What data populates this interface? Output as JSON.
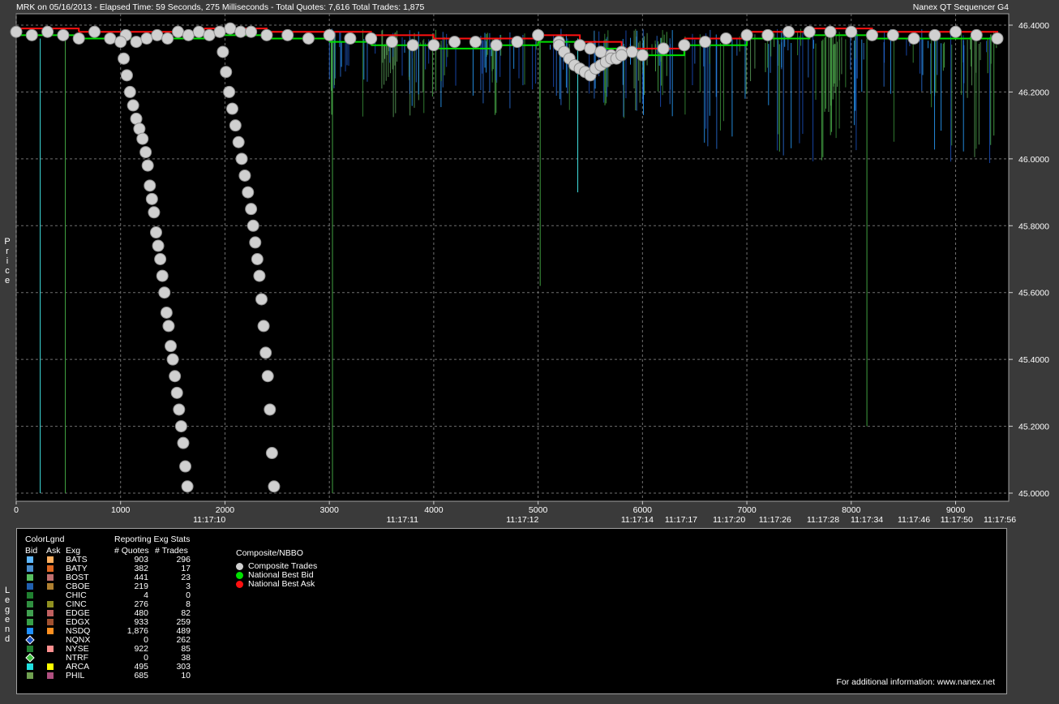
{
  "header": {
    "left": "MRK on 05/16/2013  -  Elapsed Time: 59 Seconds, 275 Milliseconds  -  Total Quotes: 7,616  Total Trades: 1,875",
    "right": "Nanex QT Sequencer G4"
  },
  "chart_data": {
    "type": "line",
    "ylabel": "Price",
    "xlim": [
      0,
      9400
    ],
    "ylim": [
      45.0,
      46.4
    ],
    "yticks": [
      "46.4000",
      "46.2000",
      "46.0000",
      "45.8000",
      "45.6000",
      "45.4000",
      "45.2000",
      "45.0000"
    ],
    "ytick_values": [
      46.4,
      46.2,
      46.0,
      45.8,
      45.6,
      45.4,
      45.2,
      45.0
    ],
    "xticks": [
      "0",
      "1000",
      "2000",
      "3000",
      "4000",
      "5000",
      "6000",
      "7000",
      "8000",
      "9000"
    ],
    "xtick_values": [
      0,
      1000,
      2000,
      3000,
      4000,
      5000,
      6000,
      7000,
      8000,
      9000
    ],
    "time_labels": [
      {
        "x": 1850,
        "label": "11:17:10"
      },
      {
        "x": 3700,
        "label": "11:17:11"
      },
      {
        "x": 4850,
        "label": "11:17:12"
      },
      {
        "x": 5950,
        "label": "11:17:14"
      },
      {
        "x": 6370,
        "label": "11:17:17"
      },
      {
        "x": 6830,
        "label": "11:17:20"
      },
      {
        "x": 7270,
        "label": "11:17:26"
      },
      {
        "x": 7730,
        "label": "11:17:28"
      },
      {
        "x": 8150,
        "label": "11:17:34"
      },
      {
        "x": 8600,
        "label": "11:17:46"
      },
      {
        "x": 9010,
        "label": "11:17:50"
      },
      {
        "x": 9440,
        "label": "11:17:56"
      }
    ],
    "grid": true,
    "series": [
      {
        "name": "Composite Trades",
        "kind": "trades",
        "x": [
          0,
          150,
          300,
          450,
          600,
          750,
          900,
          1050,
          1150,
          1250,
          1350,
          1450,
          1550,
          1650,
          1750,
          1850,
          1950,
          2050,
          2150,
          2250,
          2400,
          2600,
          2800,
          3000,
          3200,
          3400,
          3600,
          3800,
          4000,
          4200,
          4400,
          4600,
          4800,
          5000,
          5200,
          5400,
          5500,
          5600,
          5700,
          5800,
          5900,
          6000,
          6200,
          6400,
          6600,
          6800,
          7000,
          7200,
          7400,
          7600,
          7800,
          8000,
          8200,
          8400,
          8600,
          8800,
          9000,
          9200,
          9400
        ],
        "y": [
          46.38,
          46.37,
          46.38,
          46.37,
          46.36,
          46.38,
          46.36,
          46.37,
          46.35,
          46.36,
          46.37,
          46.36,
          46.38,
          46.37,
          46.38,
          46.37,
          46.38,
          46.39,
          46.38,
          46.38,
          46.37,
          46.37,
          46.36,
          46.37,
          46.36,
          46.36,
          46.35,
          46.34,
          46.34,
          46.35,
          46.35,
          46.34,
          46.35,
          46.37,
          46.35,
          46.34,
          46.33,
          46.32,
          46.31,
          46.32,
          46.32,
          46.31,
          46.33,
          46.34,
          46.35,
          46.36,
          46.37,
          46.37,
          46.38,
          46.38,
          46.38,
          46.38,
          46.37,
          46.37,
          46.36,
          46.37,
          46.38,
          46.37,
          46.36
        ]
      },
      {
        "name": "Composite Trades",
        "kind": "trades",
        "x": [
          1000,
          1030,
          1060,
          1090,
          1120,
          1150,
          1180,
          1210,
          1240,
          1260,
          1280,
          1300,
          1320,
          1340,
          1360,
          1380,
          1400,
          1420,
          1440,
          1460,
          1480,
          1500,
          1520,
          1540,
          1560,
          1580,
          1600,
          1620,
          1640
        ],
        "y": [
          46.35,
          46.3,
          46.25,
          46.2,
          46.16,
          46.12,
          46.09,
          46.06,
          46.02,
          45.98,
          45.92,
          45.88,
          45.84,
          45.78,
          45.74,
          45.7,
          45.65,
          45.6,
          45.54,
          45.5,
          45.44,
          45.4,
          45.35,
          45.3,
          45.25,
          45.2,
          45.15,
          45.08,
          45.02
        ]
      },
      {
        "name": "Composite Trades",
        "kind": "trades",
        "x": [
          1950,
          1980,
          2010,
          2040,
          2070,
          2100,
          2130,
          2160,
          2190,
          2220,
          2250,
          2270,
          2290,
          2310,
          2330,
          2350,
          2370,
          2390,
          2410,
          2430,
          2450,
          2470
        ],
        "y": [
          46.38,
          46.32,
          46.26,
          46.2,
          46.15,
          46.1,
          46.05,
          46.0,
          45.95,
          45.9,
          45.85,
          45.8,
          45.75,
          45.7,
          45.65,
          45.58,
          45.5,
          45.42,
          45.35,
          45.25,
          45.12,
          45.02
        ]
      },
      {
        "name": "Composite Trades",
        "kind": "trades",
        "x": [
          5200,
          5250,
          5300,
          5350,
          5400,
          5450,
          5500,
          5550,
          5600,
          5650,
          5700,
          5750,
          5800
        ],
        "y": [
          46.34,
          46.32,
          46.3,
          46.28,
          46.27,
          46.26,
          46.25,
          46.27,
          46.28,
          46.29,
          46.3,
          46.3,
          46.31
        ]
      },
      {
        "name": "National Best Bid",
        "kind": "step",
        "x": [
          0,
          600,
          1200,
          1800,
          2400,
          3000,
          3400,
          4000,
          4600,
          5000,
          5400,
          5800,
          6400,
          7000,
          7600,
          8200,
          8800,
          9400
        ],
        "y": [
          46.37,
          46.36,
          46.36,
          46.37,
          46.36,
          46.35,
          46.34,
          46.33,
          46.34,
          46.35,
          46.33,
          46.31,
          46.34,
          46.36,
          46.37,
          46.36,
          46.36,
          46.35
        ]
      },
      {
        "name": "National Best Ask",
        "kind": "step",
        "x": [
          0,
          600,
          1200,
          1800,
          2400,
          3000,
          3400,
          4000,
          4600,
          5000,
          5400,
          5800,
          6400,
          7000,
          7600,
          8200,
          8800,
          9400
        ],
        "y": [
          46.39,
          46.38,
          46.38,
          46.39,
          46.38,
          46.38,
          46.37,
          46.36,
          46.36,
          46.37,
          46.35,
          46.33,
          46.36,
          46.38,
          46.39,
          46.38,
          46.38,
          46.37
        ]
      }
    ]
  },
  "legend": {
    "color_title": "ColorLgnd",
    "bid_label": "Bid",
    "ask_label": "Ask",
    "exg_label": "Exg",
    "stats_title": "Reporting Exg Stats",
    "quotes_label": "# Quotes",
    "trades_label": "# Trades",
    "rows": [
      {
        "exg": "BATS",
        "quotes": "903",
        "trades": "296",
        "bid": "#5fb8ff",
        "ask": "#ffb060",
        "bid_shape": "square"
      },
      {
        "exg": "BATY",
        "quotes": "382",
        "trades": "17",
        "bid": "#4a8fd0",
        "ask": "#e06820",
        "bid_shape": "square"
      },
      {
        "exg": "BOST",
        "quotes": "441",
        "trades": "23",
        "bid": "#58c060",
        "ask": "#c07070",
        "bid_shape": "square"
      },
      {
        "exg": "CBOE",
        "quotes": "219",
        "trades": "3",
        "bid": "#2060b0",
        "ask": "#b08030",
        "bid_shape": "square"
      },
      {
        "exg": "CHIC",
        "quotes": "4",
        "trades": "0",
        "bid": "#208030",
        "ask": "#000000",
        "bid_shape": "square"
      },
      {
        "exg": "CINC",
        "quotes": "276",
        "trades": "8",
        "bid": "#309040",
        "ask": "#909020",
        "bid_shape": "square"
      },
      {
        "exg": "EDGE",
        "quotes": "480",
        "trades": "82",
        "bid": "#40a050",
        "ask": "#c06060",
        "bid_shape": "square"
      },
      {
        "exg": "EDGX",
        "quotes": "933",
        "trades": "259",
        "bid": "#38a048",
        "ask": "#a05030",
        "bid_shape": "square"
      },
      {
        "exg": "NSDQ",
        "quotes": "1,876",
        "trades": "489",
        "bid": "#2090ff",
        "ask": "#ff9020",
        "bid_shape": "square"
      },
      {
        "exg": "NQNX",
        "quotes": "0",
        "trades": "262",
        "bid": "#1a50c0",
        "ask": "#000000",
        "bid_shape": "diamond"
      },
      {
        "exg": "NYSE",
        "quotes": "922",
        "trades": "85",
        "bid": "#208030",
        "ask": "#ff9090",
        "bid_shape": "square"
      },
      {
        "exg": "NTRF",
        "quotes": "0",
        "trades": "38",
        "bid": "#40c040",
        "ask": "#000000",
        "bid_shape": "diamond"
      },
      {
        "exg": "ARCA",
        "quotes": "495",
        "trades": "303",
        "bid": "#20e0e0",
        "ask": "#ffff00",
        "bid_shape": "square"
      },
      {
        "exg": "PHIL",
        "quotes": "685",
        "trades": "10",
        "bid": "#70a050",
        "ask": "#b05080",
        "bid_shape": "square"
      }
    ],
    "nbbo_title": "Composite/NBBO",
    "nbbo_items": [
      {
        "label": "Composite Trades",
        "color": "#d0d0d0"
      },
      {
        "label": "National Best Bid",
        "color": "#00e000"
      },
      {
        "label": "National Best Ask",
        "color": "#ff1010"
      }
    ],
    "side_label": "Legend"
  },
  "footer": {
    "text": "For additional information: www.nanex.net"
  }
}
